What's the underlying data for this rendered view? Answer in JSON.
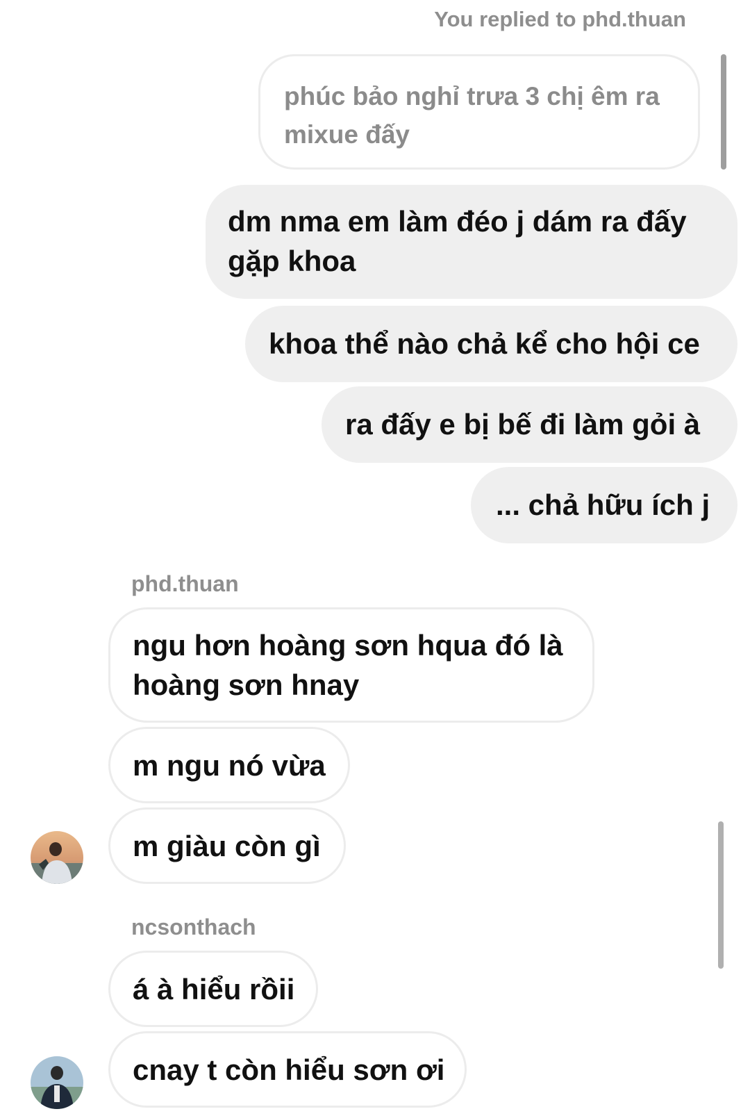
{
  "reply_context": {
    "label": "You replied to phd.thuan",
    "quoted_text": "phúc bảo nghỉ trưa 3 chị êm ra mixue đấy"
  },
  "outgoing_messages": [
    {
      "line1": "dm nma em làm đéo j dám ra đấy",
      "line2": "gặp khoa"
    },
    {
      "line1": "khoa thể nào chả kể cho hội ce"
    },
    {
      "line1": "ra đấy e bị bế đi làm gỏi à"
    },
    {
      "line1": "... chả hữu ích j"
    }
  ],
  "groups": [
    {
      "sender": "phd.thuan",
      "avatar_icon": "profile-photo-icon",
      "messages": [
        {
          "line1": "ngu hơn hoàng sơn hqua đó là",
          "line2": "hoàng sơn hnay"
        },
        {
          "line1": "m ngu nó vừa"
        },
        {
          "line1": "m giàu còn gì"
        }
      ]
    },
    {
      "sender": "ncsonthach",
      "avatar_icon": "profile-photo-icon",
      "messages": [
        {
          "line1": "á à hiểu rồii"
        },
        {
          "line1": "cnay t còn hiểu sơn ơi"
        }
      ]
    }
  ],
  "colors": {
    "outgoing_bubble": "#efefef",
    "incoming_border": "#ececec",
    "meta_text": "#8e8e8e",
    "message_text": "#111111"
  }
}
